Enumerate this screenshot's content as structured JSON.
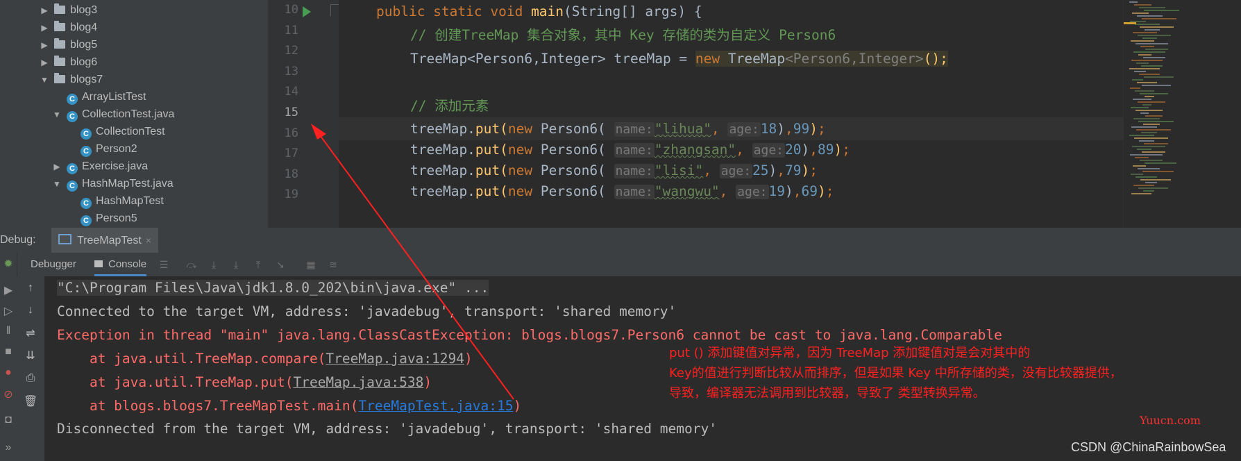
{
  "tree": {
    "items": [
      {
        "label": "blog3",
        "kind": "folder",
        "expanded": false
      },
      {
        "label": "blog4",
        "kind": "folder",
        "expanded": false
      },
      {
        "label": "blog5",
        "kind": "folder",
        "expanded": false
      },
      {
        "label": "blog6",
        "kind": "folder",
        "expanded": false
      },
      {
        "label": "blogs7",
        "kind": "folder",
        "expanded": true
      },
      {
        "label": "ArrayListTest",
        "kind": "class"
      },
      {
        "label": "CollectionTest.java",
        "kind": "class",
        "expanded": true
      },
      {
        "label": "CollectionTest",
        "kind": "class"
      },
      {
        "label": "Person2",
        "kind": "class"
      },
      {
        "label": "Exercise.java",
        "kind": "class",
        "expanded": false
      },
      {
        "label": "HashMapTest.java",
        "kind": "class",
        "expanded": true
      },
      {
        "label": "HashMapTest",
        "kind": "class"
      },
      {
        "label": "Person5",
        "kind": "class"
      }
    ]
  },
  "editor": {
    "line_numbers": [
      "10",
      "11",
      "12",
      "13",
      "14",
      "15",
      "16",
      "17",
      "18",
      "19"
    ],
    "current_line": "15",
    "code": {
      "l10": {
        "kw1": "public static void ",
        "fn": "main",
        "rest": "(String[] args) {"
      },
      "l11": "// 创建TreeMap 集合对象，其中 Key 存储的类为自定义 Person6",
      "l12": {
        "a": "TreeMap<Person6,Integer> treeMap = ",
        "kw": "new",
        "b": " TreeMap",
        "g1": "<Person6,Integer>",
        "c": "();"
      },
      "l14": "// 添加元素",
      "puts": [
        {
          "obj": "treeMap.",
          "fn": "put",
          "kw": "new",
          "cls": " Person6(",
          "hint_name": "name:",
          "str": "\"lihua\"",
          "hint_age": "age:",
          "age": "18",
          "score": "99"
        },
        {
          "obj": "treeMap.",
          "fn": "put",
          "kw": "new",
          "cls": " Person6(",
          "hint_name": "name:",
          "str": "\"zhangsan\"",
          "hint_age": "age:",
          "age": "20",
          "score": "89"
        },
        {
          "obj": "treeMap.",
          "fn": "put",
          "kw": "new",
          "cls": " Person6(",
          "hint_name": "name:",
          "str": "\"lisi\"",
          "hint_age": "age:",
          "age": "25",
          "score": "79"
        },
        {
          "obj": "treeMap.",
          "fn": "put",
          "kw": "new",
          "cls": " Person6(",
          "hint_name": "name:",
          "str": "\"wangwu\"",
          "hint_age": "age:",
          "age": "19",
          "score": "69"
        }
      ]
    }
  },
  "debug": {
    "label": "Debug:",
    "tab": "TreeMapTest",
    "tabs": {
      "debugger": "Debugger",
      "console": "Console"
    }
  },
  "console": {
    "cmd": "\"C:\\Program Files\\Java\\jdk1.8.0_202\\bin\\java.exe\" ...",
    "connected": "Connected to the target VM, address: 'javadebug', transport: 'shared memory'",
    "exception": "Exception in thread \"main\" java.lang.ClassCastException: blogs.blogs7.Person6 cannot be cast to java.lang.Comparable",
    "stack": [
      {
        "prefix": "    at java.util.TreeMap.compare(",
        "link": "TreeMap.java:1294",
        "suffix": ")"
      },
      {
        "prefix": "    at java.util.TreeMap.put(",
        "link": "TreeMap.java:538",
        "suffix": ")"
      },
      {
        "prefix": "    at blogs.blogs7.TreeMapTest.main(",
        "link": "TreeMapTest.java:15",
        "suffix": ")"
      }
    ],
    "disconnected": "Disconnected from the target VM, address: 'javadebug', transport: 'shared memory'"
  },
  "annotation": {
    "lines": [
      "put () 添加键值对异常，因为 TreeMap 添加键值对是会对其中的",
      "Key的值进行判断比较从而排序，但是如果 Key 中所存储的类，没有比较器提供，",
      "导致，编译器无法调用到比较器，导致了 类型转换异常。"
    ],
    "color": "#ff2020"
  },
  "watermarks": {
    "site": "Yuucn.com",
    "csdn": "CSDN @ChinaRainbowSea"
  }
}
